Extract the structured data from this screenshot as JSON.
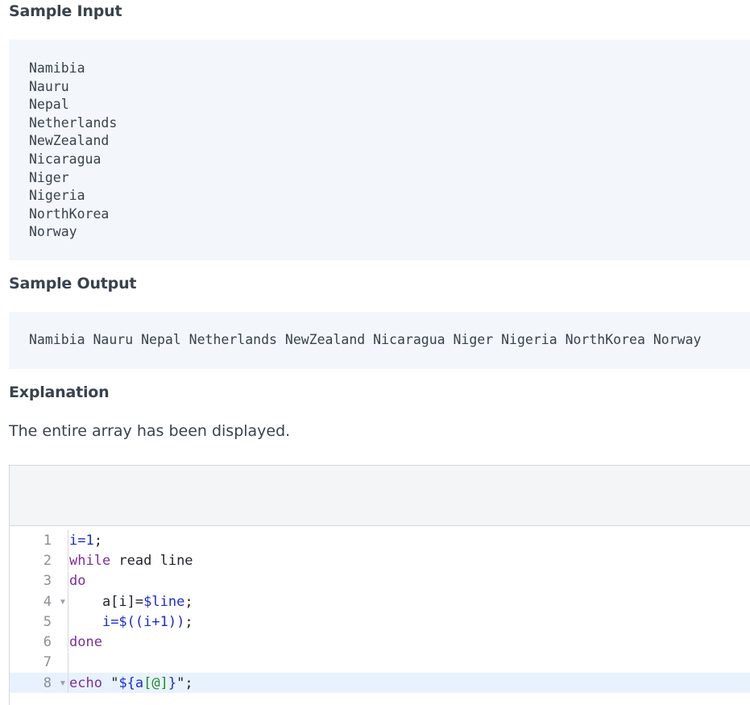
{
  "sample_input": {
    "heading": "Sample Input",
    "lines": [
      "Namibia",
      "Nauru",
      "Nepal",
      "Netherlands",
      "NewZealand",
      "Nicaragua",
      "Niger",
      "Nigeria",
      "NorthKorea",
      "Norway"
    ]
  },
  "sample_output": {
    "heading": "Sample Output",
    "text": "Namibia Nauru Nepal Netherlands NewZealand Nicaragua Niger Nigeria NorthKorea Norway"
  },
  "explanation": {
    "heading": "Explanation",
    "text": "The entire array has been displayed."
  },
  "editor": {
    "lines": [
      {
        "num": "1",
        "fold": "",
        "tokens": [
          {
            "t": "i=1",
            "c": "var"
          },
          {
            "t": ";",
            "c": "plain"
          }
        ]
      },
      {
        "num": "2",
        "fold": "",
        "tokens": [
          {
            "t": "while",
            "c": "kw"
          },
          {
            "t": " read line",
            "c": "plain"
          }
        ]
      },
      {
        "num": "3",
        "fold": "",
        "tokens": [
          {
            "t": "do",
            "c": "kw"
          }
        ]
      },
      {
        "num": "4",
        "fold": "▼",
        "tokens": [
          {
            "t": "    a[i]=",
            "c": "plain"
          },
          {
            "t": "$line",
            "c": "var"
          },
          {
            "t": ";",
            "c": "plain"
          }
        ]
      },
      {
        "num": "5",
        "fold": "",
        "tokens": [
          {
            "t": "    ",
            "c": "plain"
          },
          {
            "t": "i=$((i+1))",
            "c": "var"
          },
          {
            "t": ";",
            "c": "plain"
          }
        ]
      },
      {
        "num": "6",
        "fold": "",
        "tokens": [
          {
            "t": "done",
            "c": "kw"
          }
        ]
      },
      {
        "num": "7",
        "fold": "",
        "tokens": []
      },
      {
        "num": "8",
        "fold": "▼",
        "active": true,
        "tokens": [
          {
            "t": "echo",
            "c": "kw"
          },
          {
            "t": " \"",
            "c": "plain"
          },
          {
            "t": "${a",
            "c": "var"
          },
          {
            "t": "[@]",
            "c": "green"
          },
          {
            "t": "}",
            "c": "var"
          },
          {
            "t": "\";",
            "c": "plain"
          }
        ]
      }
    ]
  }
}
